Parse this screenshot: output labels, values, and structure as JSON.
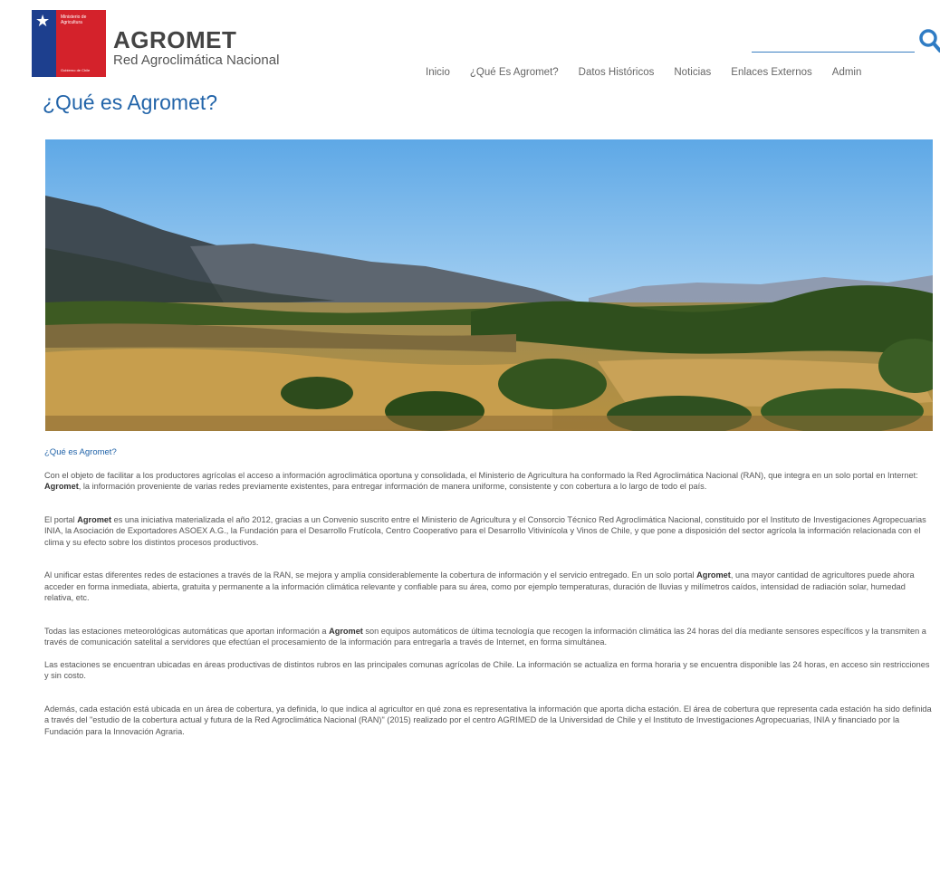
{
  "header": {
    "logo_line1": "Ministerio de Agricultura",
    "logo_line2": "Gobierno de Chile",
    "brand_name": "AGROMET",
    "brand_sub": "Red Agroclimática Nacional",
    "search_placeholder": ""
  },
  "nav": {
    "items": [
      "Inicio",
      "¿Qué Es Agromet?",
      "Datos Históricos",
      "Noticias",
      "Enlaces Externos",
      "Admin"
    ]
  },
  "page": {
    "title": "¿Qué es Agromet?",
    "subtitle": "¿Qué es Agromet?"
  },
  "paragraphs": [
    {
      "before": "Con el objeto de facilitar a los productores agrícolas el acceso a información agroclimática oportuna y consolidada, el Ministerio de Agricultura ha conformado la Red Agroclimática Nacional (RAN), que integra en un solo portal en Internet: ",
      "bold": "Agromet",
      "after": ", la información proveniente de varias redes previamente existentes, para entregar información de manera uniforme, consistente y con cobertura a lo largo de todo el país."
    },
    {
      "before": "El portal ",
      "bold": "Agromet",
      "after": " es una iniciativa materializada el año 2012, gracias a un Convenio suscrito entre el Ministerio de Agricultura y el Consorcio Técnico Red Agroclimática Nacional, constituido por el Instituto de Investigaciones Agropecuarias INIA, la Asociación de Exportadores ASOEX A.G., la Fundación para el Desarrollo Frutícola, Centro Cooperativo para el Desarrollo Vitivinícola y Vinos de Chile, y que pone a disposición del sector agrícola la información relacionada con el clima y su efecto sobre los distintos procesos productivos."
    },
    {
      "before": "Al unificar estas diferentes redes de estaciones a través de la RAN, se mejora y amplía considerablemente la cobertura de información y el servicio entregado. En un solo portal ",
      "bold": "Agromet",
      "after": ", una mayor cantidad de agricultores puede ahora acceder en forma inmediata, abierta, gratuita y permanente a la información climática relevante y confiable para su área, como por ejemplo temperaturas, duración de lluvias y milímetros caídos, intensidad de radiación solar, humedad relativa, etc."
    },
    {
      "before": "Todas las estaciones meteorológicas automáticas que aportan información a ",
      "bold": "Agromet",
      "after": " son equipos automáticos de última tecnología que recogen la información climática las 24 horas del día mediante sensores específicos y la transmiten a través de comunicación satelital a servidores que efectúan el procesamiento de la información para entregarla a través de Internet, en forma simultánea."
    },
    {
      "before": "Las estaciones se encuentran ubicadas en áreas productivas de distintos rubros en las principales comunas agrícolas de Chile. La información se actualiza en forma horaria y se encuentra disponible las 24 horas, en acceso sin restricciones y sin costo.",
      "bold": "",
      "after": ""
    },
    {
      "before": "Además, cada estación está ubicada en un área de cobertura, ya definida, lo que indica al agricultor en qué zona es representativa la información que aporta dicha estación. El área de cobertura que representa cada estación ha sido definida a través del \"estudio de la cobertura actual y futura de la Red Agroclimática Nacional (RAN)\" (2015) realizado por el centro AGRIMED de la Universidad de Chile y el Instituto de Investigaciones Agropecuarias, INIA y financiado por la Fundación para la Innovación Agraria.",
      "bold": "",
      "after": ""
    }
  ]
}
